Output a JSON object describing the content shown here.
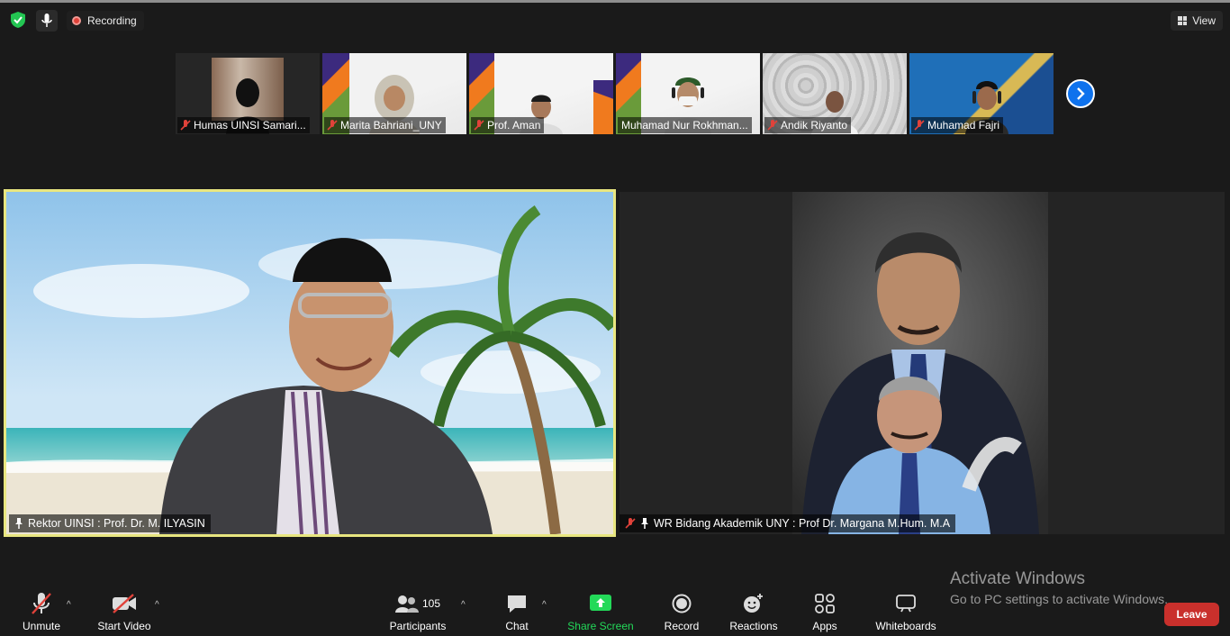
{
  "topbar": {
    "recording_label": "Recording",
    "view_label": "View"
  },
  "thumbnails": [
    {
      "name": "Humas UINSI Samari..."
    },
    {
      "name": "Marita Bahriani_UNY"
    },
    {
      "name": "Prof. Aman"
    },
    {
      "name": "Muhamad Nur Rokhman..."
    },
    {
      "name": "Andik Riyanto"
    },
    {
      "name": "Muhamad Fajri"
    }
  ],
  "main_tiles": {
    "left_name": "Rektor UINSI : Prof. Dr. M. ILYASIN",
    "right_name": "WR Bidang Akademik UNY : Prof Dr. Margana M.Hum. M.A"
  },
  "toolbar": {
    "unmute": "Unmute",
    "start_video": "Start Video",
    "participants": "Participants",
    "participants_count": "105",
    "chat": "Chat",
    "share_screen": "Share Screen",
    "record": "Record",
    "reactions": "Reactions",
    "apps": "Apps",
    "whiteboards": "Whiteboards",
    "leave": "Leave"
  },
  "watermark": {
    "title": "Activate Windows",
    "subtitle": "Go to PC settings to activate Windows."
  },
  "colors": {
    "accent_blue": "#0e72ed",
    "share_green": "#23d959",
    "leave_red": "#c9302c",
    "active_speaker": "#e8e680"
  }
}
